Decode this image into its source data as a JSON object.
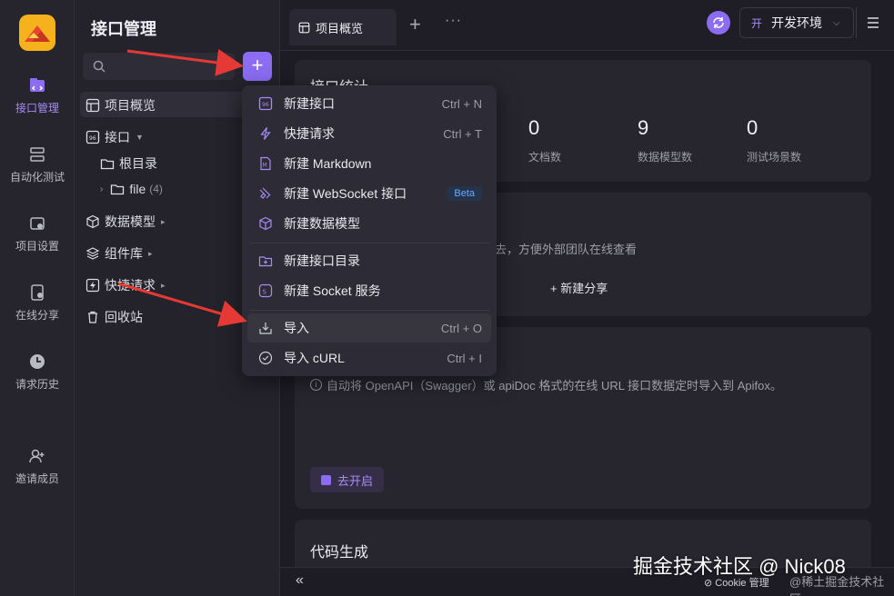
{
  "rail": {
    "items": [
      {
        "label": "接口管理"
      },
      {
        "label": "自动化测试"
      },
      {
        "label": "项目设置"
      },
      {
        "label": "在线分享"
      },
      {
        "label": "请求历史"
      },
      {
        "label": "邀请成员"
      }
    ]
  },
  "side": {
    "title": "接口管理",
    "tree": [
      {
        "label": "项目概览"
      },
      {
        "label": "接口"
      },
      {
        "label": "根目录"
      },
      {
        "label": "file",
        "count": "(4)"
      },
      {
        "label": "数据模型"
      },
      {
        "label": "组件库"
      },
      {
        "label": "快捷请求"
      },
      {
        "label": "回收站"
      }
    ]
  },
  "topbar": {
    "tab_label": "项目概览",
    "env_badge": "开",
    "env_label": "开发环境"
  },
  "main": {
    "stats_title": "接口统计",
    "stats": [
      {
        "value": "0",
        "label": "文档数"
      },
      {
        "value": "9",
        "label": "数据模型数"
      },
      {
        "value": "0",
        "label": "测试场景数"
      }
    ],
    "share_desc": "去，方便外部团队在线查看",
    "share_button": "新建分享",
    "import_desc": "自动将 OpenAPI（Swagger）或 apiDoc 格式的在线 URL 接口数据定时导入到 Apifox。",
    "import_button": "去开启",
    "codegen_title": "代码生成",
    "cookie_label": "Cookie 管理"
  },
  "menu": {
    "items": [
      {
        "label": "新建接口",
        "shortcut": "Ctrl + N"
      },
      {
        "label": "快捷请求",
        "shortcut": "Ctrl + T"
      },
      {
        "label": "新建 Markdown"
      },
      {
        "label": "新建 WebSocket 接口",
        "tag": "Beta"
      },
      {
        "label": "新建数据模型"
      },
      {
        "label": "新建接口目录"
      },
      {
        "label": "新建 Socket 服务"
      },
      {
        "label": "导入",
        "shortcut": "Ctrl + O"
      },
      {
        "label": "导入 cURL",
        "shortcut": "Ctrl + I"
      }
    ]
  },
  "watermark": {
    "text": "掘金技术社区 @ Nick08",
    "text2": "@稀土掘金技术社区"
  },
  "colors": {
    "accent": "#8b6cf2",
    "arrow": "#e53935"
  }
}
